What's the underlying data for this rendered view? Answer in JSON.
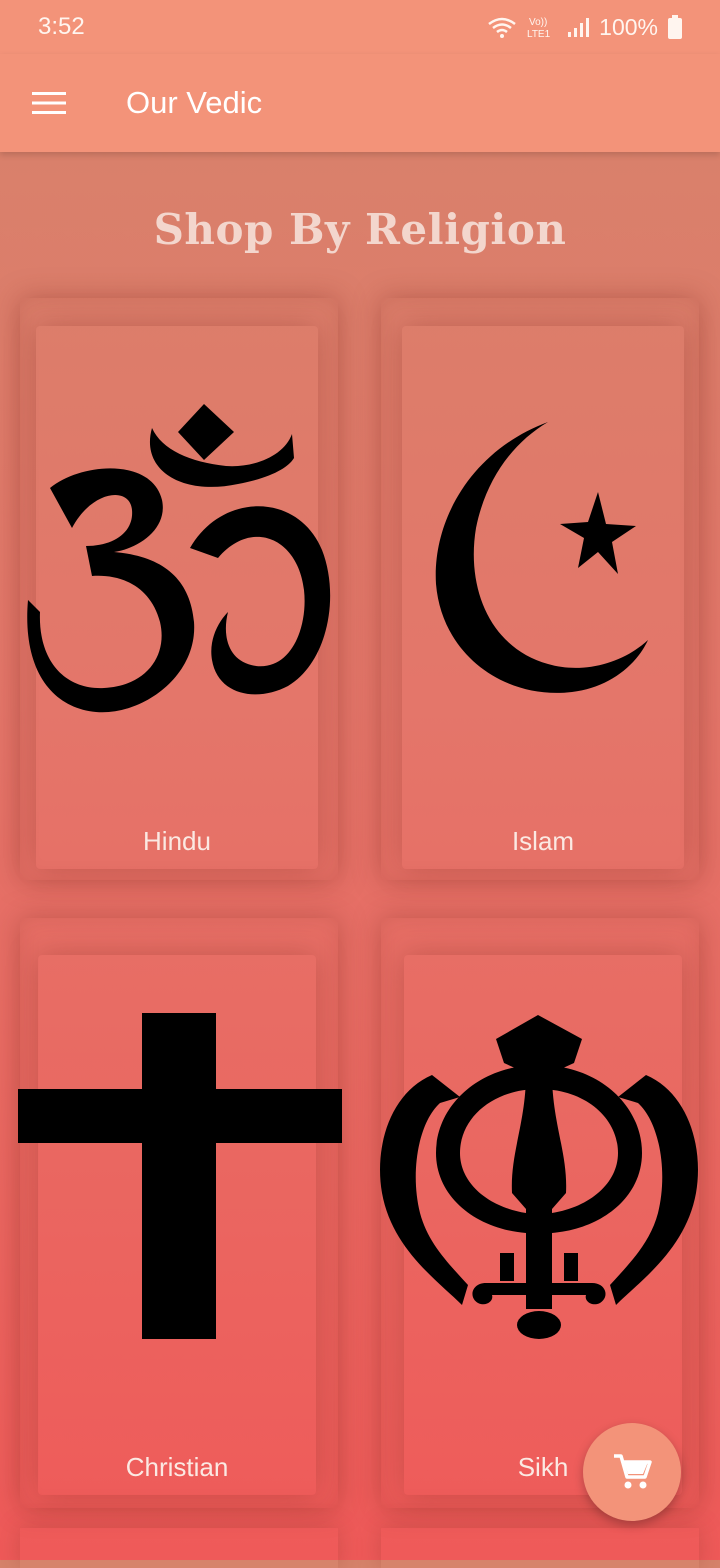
{
  "status": {
    "time": "3:52",
    "battery": "100%",
    "network_label": "VoLTE1"
  },
  "app_bar": {
    "title": "Our Vedic"
  },
  "section": {
    "title": "Shop By Religion"
  },
  "religions": [
    {
      "label": "Hindu",
      "icon": "om-icon"
    },
    {
      "label": "Islam",
      "icon": "crescent-star-icon"
    },
    {
      "label": "Christian",
      "icon": "cross-icon"
    },
    {
      "label": "Sikh",
      "icon": "khanda-icon"
    }
  ],
  "colors": {
    "accent": "#f39379",
    "background_top": "#d6836b",
    "background_bottom": "#ef5a59"
  }
}
